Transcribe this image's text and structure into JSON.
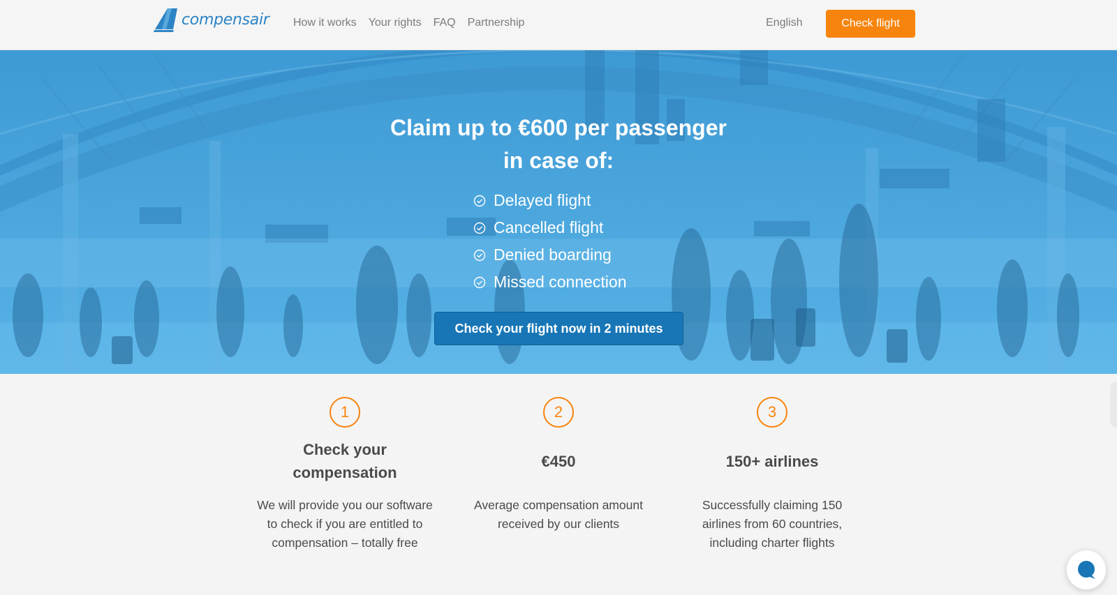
{
  "brand": {
    "name": "compensair",
    "primary_color": "#2c84c6",
    "accent_color": "#f7840d",
    "cta_color": "#1876b6"
  },
  "header": {
    "nav": [
      {
        "label": "How it works"
      },
      {
        "label": "Your rights"
      },
      {
        "label": "FAQ"
      },
      {
        "label": "Partnership"
      }
    ],
    "language": "English",
    "check_button": "Check flight"
  },
  "hero": {
    "title_line1": "Claim up to €600 per passenger",
    "title_line2": "in case of:",
    "bullets": [
      {
        "label": "Delayed flight",
        "icon": "check-circle-icon"
      },
      {
        "label": "Cancelled flight",
        "icon": "check-circle-icon"
      },
      {
        "label": "Denied boarding",
        "icon": "check-circle-icon"
      },
      {
        "label": "Missed connection",
        "icon": "check-circle-icon"
      }
    ],
    "cta": "Check your flight now in 2 minutes"
  },
  "features": [
    {
      "number": "1",
      "title": "Check your compensation",
      "description": "We will provide you our software to check if you are entitled to compensation – totally free"
    },
    {
      "number": "2",
      "title": "€450",
      "description": "Average compensation amount received by our clients"
    },
    {
      "number": "3",
      "title": "150+ airlines",
      "description": "Successfully claiming 150 airlines from 60 countries, including charter flights"
    }
  ],
  "chat": {
    "icon": "chat-bubble-icon"
  }
}
